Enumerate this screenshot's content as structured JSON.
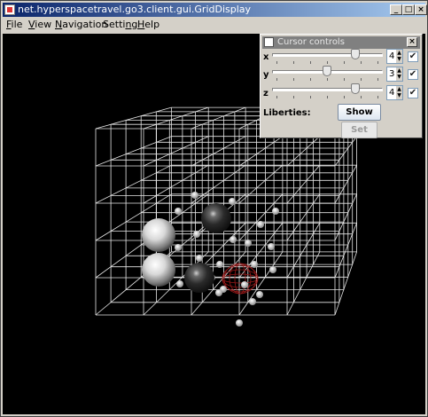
{
  "window": {
    "title": "net.hyperspacetravel.go3.client.gui.GridDisplay",
    "buttons": {
      "minimize": "_",
      "maximize": "□",
      "close": "×"
    }
  },
  "menu": [
    {
      "label": "File",
      "underline": "F",
      "rest": "ile"
    },
    {
      "label": "View",
      "underline": "V",
      "rest": "iew"
    },
    {
      "label": "Navigation",
      "underline": "N",
      "rest": "avigation"
    },
    {
      "label": "Setting",
      "pre": "Setti",
      "underline": "n",
      "rest": "g"
    },
    {
      "label": "Help",
      "underline": "H",
      "rest": "elp"
    }
  ],
  "cursor_controls": {
    "title": "Cursor controls",
    "close": "×",
    "axes": [
      {
        "label": "x",
        "value": "4",
        "slider_fraction": 0.75,
        "checked": true
      },
      {
        "label": "y",
        "value": "3",
        "slider_fraction": 0.5,
        "checked": true
      },
      {
        "label": "z",
        "value": "4",
        "slider_fraction": 0.75,
        "checked": true
      }
    ],
    "liberties_label": "Liberties:",
    "show_button": "Show",
    "set_button": "Set",
    "check_glyph": "✔",
    "spin_up": "▲",
    "spin_down": "▼"
  },
  "scene": {
    "grid_color": "#ffffff",
    "background": "#000000",
    "white_stones": 2,
    "black_stones": 2
  }
}
